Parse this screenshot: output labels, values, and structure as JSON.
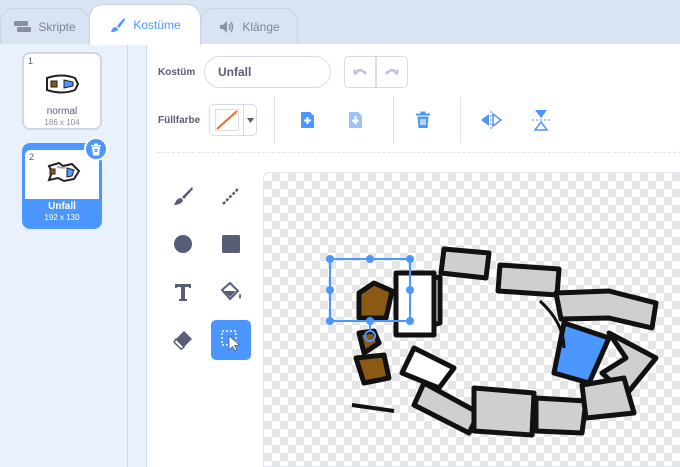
{
  "tabs": [
    {
      "label": "Skripte",
      "icon": "code-blocks-icon"
    },
    {
      "label": "Kostüme",
      "icon": "paintbrush-icon"
    },
    {
      "label": "Klänge",
      "icon": "speaker-icon"
    }
  ],
  "costumes": [
    {
      "number": "1",
      "name": "normal",
      "size": "186 x 104"
    },
    {
      "number": "2",
      "name": "Unfall",
      "size": "192 x 130"
    }
  ],
  "editor": {
    "costume_label": "Kostüm",
    "costume_name": "Unfall",
    "fill_label": "Füllfarbe",
    "fill_color": "none",
    "accent_color": "#4c97ff"
  },
  "toolbar": {
    "icons": [
      "undo-icon",
      "redo-icon",
      "forward-layer-icon",
      "backward-layer-icon",
      "delete-icon",
      "flip-horizontal-icon",
      "flip-vertical-icon"
    ]
  },
  "tools": [
    "brush-icon",
    "line-icon",
    "circle-icon",
    "rectangle-icon",
    "text-icon",
    "fill-bucket-icon",
    "eraser-icon",
    "select-icon"
  ]
}
